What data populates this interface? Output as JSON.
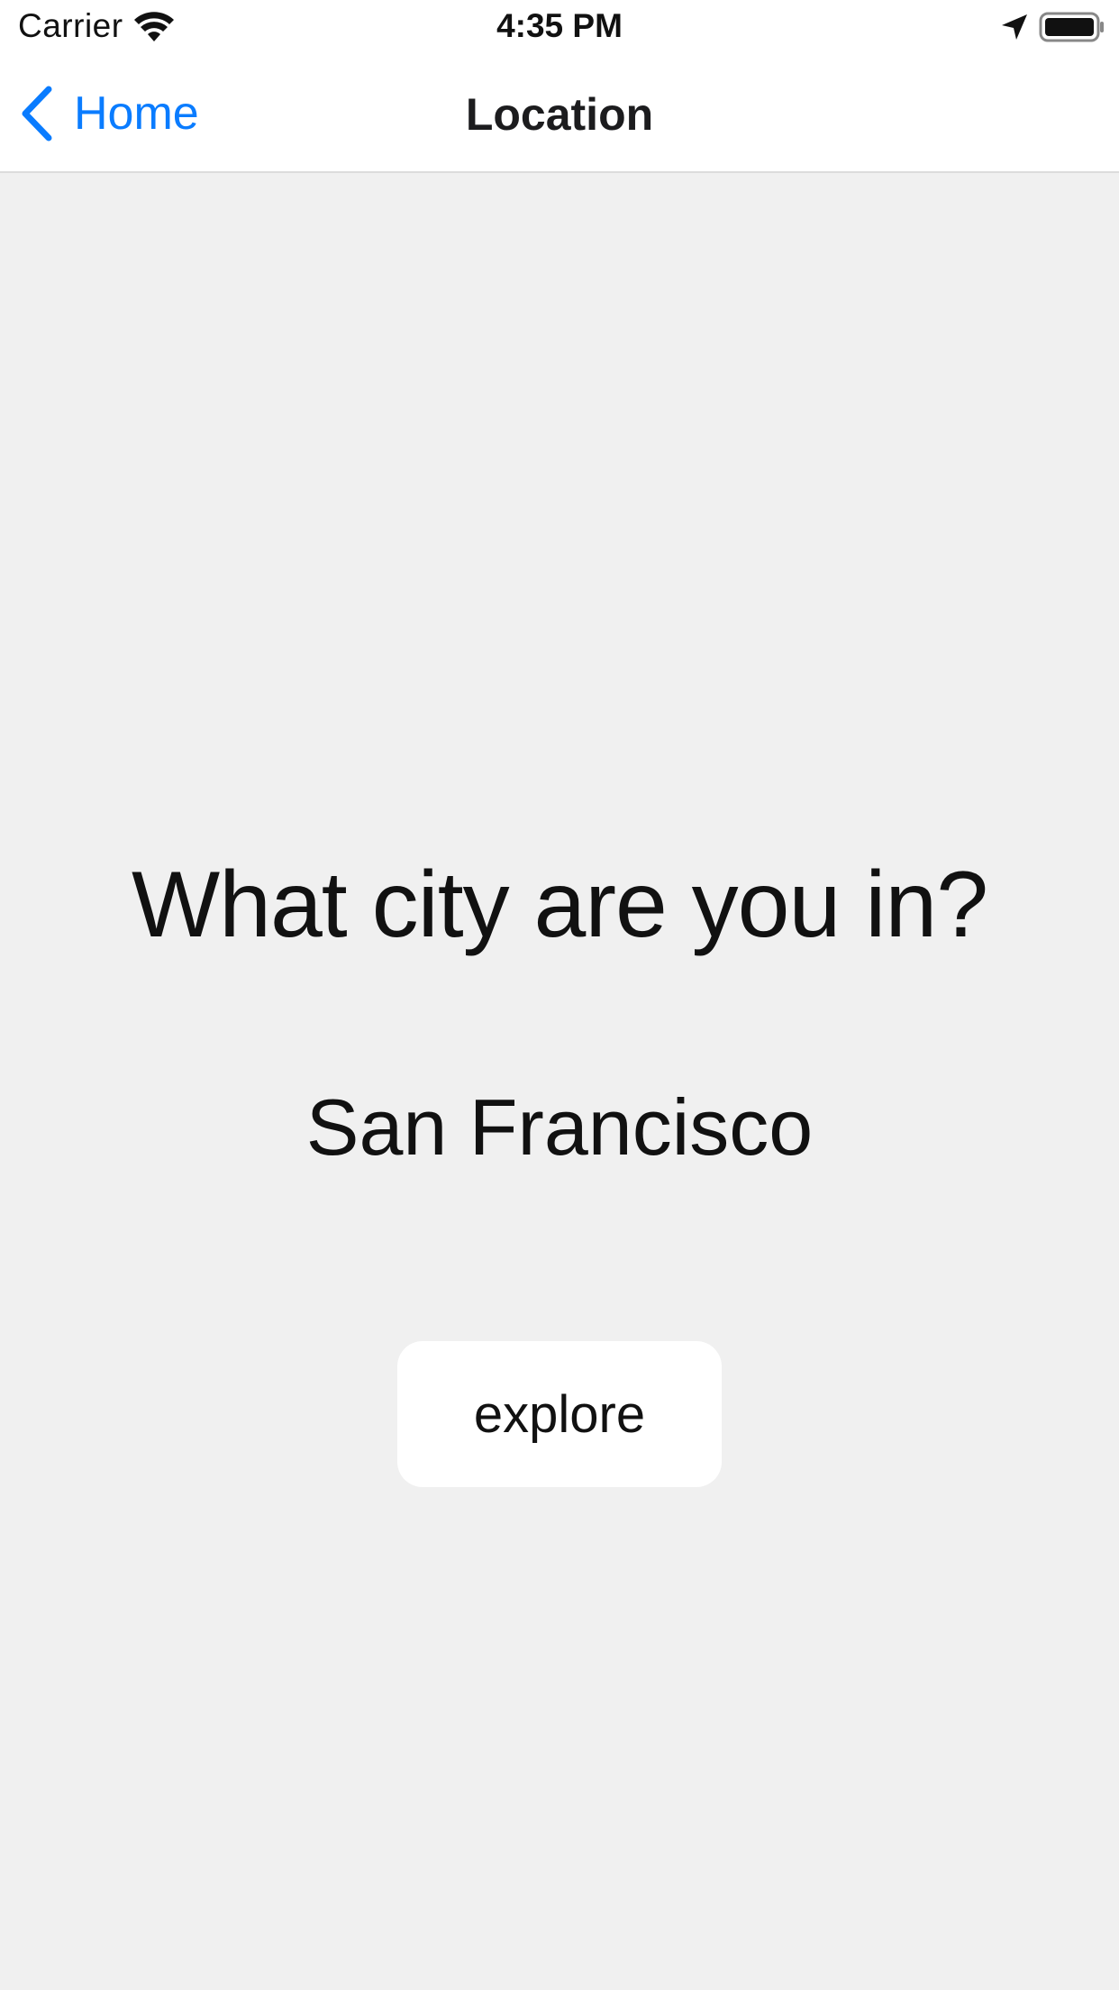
{
  "status_bar": {
    "carrier": "Carrier",
    "time": "4:35 PM",
    "icons": [
      "wifi-icon",
      "location-arrow-icon",
      "battery-icon"
    ]
  },
  "nav_bar": {
    "back_label": "Home",
    "back_icon": "chevron-left-icon",
    "title": "Location"
  },
  "main": {
    "question": "What city are you in?",
    "city": "San Francisco",
    "explore_label": "explore"
  },
  "colors": {
    "accent": "#0a7cff",
    "background": "#f0f0f0",
    "surface": "#ffffff",
    "text": "#111111"
  }
}
